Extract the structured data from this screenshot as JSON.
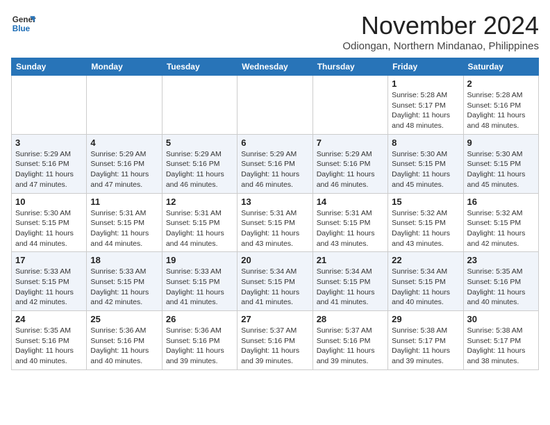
{
  "logo": {
    "line1": "General",
    "line2": "Blue"
  },
  "title": "November 2024",
  "location": "Odiongan, Northern Mindanao, Philippines",
  "weekdays": [
    "Sunday",
    "Monday",
    "Tuesday",
    "Wednesday",
    "Thursday",
    "Friday",
    "Saturday"
  ],
  "weeks": [
    [
      {
        "day": "",
        "info": ""
      },
      {
        "day": "",
        "info": ""
      },
      {
        "day": "",
        "info": ""
      },
      {
        "day": "",
        "info": ""
      },
      {
        "day": "",
        "info": ""
      },
      {
        "day": "1",
        "info": "Sunrise: 5:28 AM\nSunset: 5:17 PM\nDaylight: 11 hours\nand 48 minutes."
      },
      {
        "day": "2",
        "info": "Sunrise: 5:28 AM\nSunset: 5:16 PM\nDaylight: 11 hours\nand 48 minutes."
      }
    ],
    [
      {
        "day": "3",
        "info": "Sunrise: 5:29 AM\nSunset: 5:16 PM\nDaylight: 11 hours\nand 47 minutes."
      },
      {
        "day": "4",
        "info": "Sunrise: 5:29 AM\nSunset: 5:16 PM\nDaylight: 11 hours\nand 47 minutes."
      },
      {
        "day": "5",
        "info": "Sunrise: 5:29 AM\nSunset: 5:16 PM\nDaylight: 11 hours\nand 46 minutes."
      },
      {
        "day": "6",
        "info": "Sunrise: 5:29 AM\nSunset: 5:16 PM\nDaylight: 11 hours\nand 46 minutes."
      },
      {
        "day": "7",
        "info": "Sunrise: 5:29 AM\nSunset: 5:16 PM\nDaylight: 11 hours\nand 46 minutes."
      },
      {
        "day": "8",
        "info": "Sunrise: 5:30 AM\nSunset: 5:15 PM\nDaylight: 11 hours\nand 45 minutes."
      },
      {
        "day": "9",
        "info": "Sunrise: 5:30 AM\nSunset: 5:15 PM\nDaylight: 11 hours\nand 45 minutes."
      }
    ],
    [
      {
        "day": "10",
        "info": "Sunrise: 5:30 AM\nSunset: 5:15 PM\nDaylight: 11 hours\nand 44 minutes."
      },
      {
        "day": "11",
        "info": "Sunrise: 5:31 AM\nSunset: 5:15 PM\nDaylight: 11 hours\nand 44 minutes."
      },
      {
        "day": "12",
        "info": "Sunrise: 5:31 AM\nSunset: 5:15 PM\nDaylight: 11 hours\nand 44 minutes."
      },
      {
        "day": "13",
        "info": "Sunrise: 5:31 AM\nSunset: 5:15 PM\nDaylight: 11 hours\nand 43 minutes."
      },
      {
        "day": "14",
        "info": "Sunrise: 5:31 AM\nSunset: 5:15 PM\nDaylight: 11 hours\nand 43 minutes."
      },
      {
        "day": "15",
        "info": "Sunrise: 5:32 AM\nSunset: 5:15 PM\nDaylight: 11 hours\nand 43 minutes."
      },
      {
        "day": "16",
        "info": "Sunrise: 5:32 AM\nSunset: 5:15 PM\nDaylight: 11 hours\nand 42 minutes."
      }
    ],
    [
      {
        "day": "17",
        "info": "Sunrise: 5:33 AM\nSunset: 5:15 PM\nDaylight: 11 hours\nand 42 minutes."
      },
      {
        "day": "18",
        "info": "Sunrise: 5:33 AM\nSunset: 5:15 PM\nDaylight: 11 hours\nand 42 minutes."
      },
      {
        "day": "19",
        "info": "Sunrise: 5:33 AM\nSunset: 5:15 PM\nDaylight: 11 hours\nand 41 minutes."
      },
      {
        "day": "20",
        "info": "Sunrise: 5:34 AM\nSunset: 5:15 PM\nDaylight: 11 hours\nand 41 minutes."
      },
      {
        "day": "21",
        "info": "Sunrise: 5:34 AM\nSunset: 5:15 PM\nDaylight: 11 hours\nand 41 minutes."
      },
      {
        "day": "22",
        "info": "Sunrise: 5:34 AM\nSunset: 5:15 PM\nDaylight: 11 hours\nand 40 minutes."
      },
      {
        "day": "23",
        "info": "Sunrise: 5:35 AM\nSunset: 5:16 PM\nDaylight: 11 hours\nand 40 minutes."
      }
    ],
    [
      {
        "day": "24",
        "info": "Sunrise: 5:35 AM\nSunset: 5:16 PM\nDaylight: 11 hours\nand 40 minutes."
      },
      {
        "day": "25",
        "info": "Sunrise: 5:36 AM\nSunset: 5:16 PM\nDaylight: 11 hours\nand 40 minutes."
      },
      {
        "day": "26",
        "info": "Sunrise: 5:36 AM\nSunset: 5:16 PM\nDaylight: 11 hours\nand 39 minutes."
      },
      {
        "day": "27",
        "info": "Sunrise: 5:37 AM\nSunset: 5:16 PM\nDaylight: 11 hours\nand 39 minutes."
      },
      {
        "day": "28",
        "info": "Sunrise: 5:37 AM\nSunset: 5:16 PM\nDaylight: 11 hours\nand 39 minutes."
      },
      {
        "day": "29",
        "info": "Sunrise: 5:38 AM\nSunset: 5:17 PM\nDaylight: 11 hours\nand 39 minutes."
      },
      {
        "day": "30",
        "info": "Sunrise: 5:38 AM\nSunset: 5:17 PM\nDaylight: 11 hours\nand 38 minutes."
      }
    ]
  ]
}
